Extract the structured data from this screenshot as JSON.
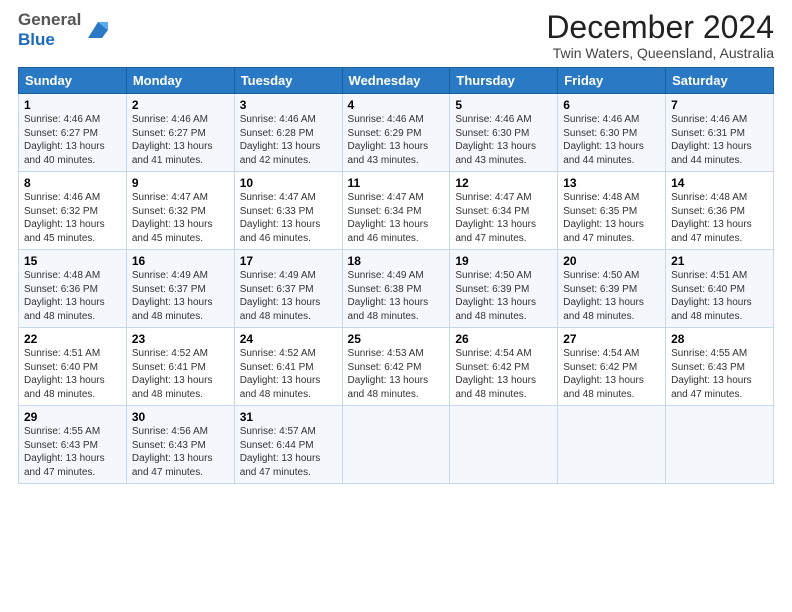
{
  "logo": {
    "general": "General",
    "blue": "Blue"
  },
  "title": "December 2024",
  "subtitle": "Twin Waters, Queensland, Australia",
  "days_header": [
    "Sunday",
    "Monday",
    "Tuesday",
    "Wednesday",
    "Thursday",
    "Friday",
    "Saturday"
  ],
  "weeks": [
    [
      {
        "day": "1",
        "sunrise": "Sunrise: 4:46 AM",
        "sunset": "Sunset: 6:27 PM",
        "daylight": "Daylight: 13 hours and 40 minutes."
      },
      {
        "day": "2",
        "sunrise": "Sunrise: 4:46 AM",
        "sunset": "Sunset: 6:27 PM",
        "daylight": "Daylight: 13 hours and 41 minutes."
      },
      {
        "day": "3",
        "sunrise": "Sunrise: 4:46 AM",
        "sunset": "Sunset: 6:28 PM",
        "daylight": "Daylight: 13 hours and 42 minutes."
      },
      {
        "day": "4",
        "sunrise": "Sunrise: 4:46 AM",
        "sunset": "Sunset: 6:29 PM",
        "daylight": "Daylight: 13 hours and 43 minutes."
      },
      {
        "day": "5",
        "sunrise": "Sunrise: 4:46 AM",
        "sunset": "Sunset: 6:30 PM",
        "daylight": "Daylight: 13 hours and 43 minutes."
      },
      {
        "day": "6",
        "sunrise": "Sunrise: 4:46 AM",
        "sunset": "Sunset: 6:30 PM",
        "daylight": "Daylight: 13 hours and 44 minutes."
      },
      {
        "day": "7",
        "sunrise": "Sunrise: 4:46 AM",
        "sunset": "Sunset: 6:31 PM",
        "daylight": "Daylight: 13 hours and 44 minutes."
      }
    ],
    [
      {
        "day": "8",
        "sunrise": "Sunrise: 4:46 AM",
        "sunset": "Sunset: 6:32 PM",
        "daylight": "Daylight: 13 hours and 45 minutes."
      },
      {
        "day": "9",
        "sunrise": "Sunrise: 4:47 AM",
        "sunset": "Sunset: 6:32 PM",
        "daylight": "Daylight: 13 hours and 45 minutes."
      },
      {
        "day": "10",
        "sunrise": "Sunrise: 4:47 AM",
        "sunset": "Sunset: 6:33 PM",
        "daylight": "Daylight: 13 hours and 46 minutes."
      },
      {
        "day": "11",
        "sunrise": "Sunrise: 4:47 AM",
        "sunset": "Sunset: 6:34 PM",
        "daylight": "Daylight: 13 hours and 46 minutes."
      },
      {
        "day": "12",
        "sunrise": "Sunrise: 4:47 AM",
        "sunset": "Sunset: 6:34 PM",
        "daylight": "Daylight: 13 hours and 47 minutes."
      },
      {
        "day": "13",
        "sunrise": "Sunrise: 4:48 AM",
        "sunset": "Sunset: 6:35 PM",
        "daylight": "Daylight: 13 hours and 47 minutes."
      },
      {
        "day": "14",
        "sunrise": "Sunrise: 4:48 AM",
        "sunset": "Sunset: 6:36 PM",
        "daylight": "Daylight: 13 hours and 47 minutes."
      }
    ],
    [
      {
        "day": "15",
        "sunrise": "Sunrise: 4:48 AM",
        "sunset": "Sunset: 6:36 PM",
        "daylight": "Daylight: 13 hours and 48 minutes."
      },
      {
        "day": "16",
        "sunrise": "Sunrise: 4:49 AM",
        "sunset": "Sunset: 6:37 PM",
        "daylight": "Daylight: 13 hours and 48 minutes."
      },
      {
        "day": "17",
        "sunrise": "Sunrise: 4:49 AM",
        "sunset": "Sunset: 6:37 PM",
        "daylight": "Daylight: 13 hours and 48 minutes."
      },
      {
        "day": "18",
        "sunrise": "Sunrise: 4:49 AM",
        "sunset": "Sunset: 6:38 PM",
        "daylight": "Daylight: 13 hours and 48 minutes."
      },
      {
        "day": "19",
        "sunrise": "Sunrise: 4:50 AM",
        "sunset": "Sunset: 6:39 PM",
        "daylight": "Daylight: 13 hours and 48 minutes."
      },
      {
        "day": "20",
        "sunrise": "Sunrise: 4:50 AM",
        "sunset": "Sunset: 6:39 PM",
        "daylight": "Daylight: 13 hours and 48 minutes."
      },
      {
        "day": "21",
        "sunrise": "Sunrise: 4:51 AM",
        "sunset": "Sunset: 6:40 PM",
        "daylight": "Daylight: 13 hours and 48 minutes."
      }
    ],
    [
      {
        "day": "22",
        "sunrise": "Sunrise: 4:51 AM",
        "sunset": "Sunset: 6:40 PM",
        "daylight": "Daylight: 13 hours and 48 minutes."
      },
      {
        "day": "23",
        "sunrise": "Sunrise: 4:52 AM",
        "sunset": "Sunset: 6:41 PM",
        "daylight": "Daylight: 13 hours and 48 minutes."
      },
      {
        "day": "24",
        "sunrise": "Sunrise: 4:52 AM",
        "sunset": "Sunset: 6:41 PM",
        "daylight": "Daylight: 13 hours and 48 minutes."
      },
      {
        "day": "25",
        "sunrise": "Sunrise: 4:53 AM",
        "sunset": "Sunset: 6:42 PM",
        "daylight": "Daylight: 13 hours and 48 minutes."
      },
      {
        "day": "26",
        "sunrise": "Sunrise: 4:54 AM",
        "sunset": "Sunset: 6:42 PM",
        "daylight": "Daylight: 13 hours and 48 minutes."
      },
      {
        "day": "27",
        "sunrise": "Sunrise: 4:54 AM",
        "sunset": "Sunset: 6:42 PM",
        "daylight": "Daylight: 13 hours and 48 minutes."
      },
      {
        "day": "28",
        "sunrise": "Sunrise: 4:55 AM",
        "sunset": "Sunset: 6:43 PM",
        "daylight": "Daylight: 13 hours and 47 minutes."
      }
    ],
    [
      {
        "day": "29",
        "sunrise": "Sunrise: 4:55 AM",
        "sunset": "Sunset: 6:43 PM",
        "daylight": "Daylight: 13 hours and 47 minutes."
      },
      {
        "day": "30",
        "sunrise": "Sunrise: 4:56 AM",
        "sunset": "Sunset: 6:43 PM",
        "daylight": "Daylight: 13 hours and 47 minutes."
      },
      {
        "day": "31",
        "sunrise": "Sunrise: 4:57 AM",
        "sunset": "Sunset: 6:44 PM",
        "daylight": "Daylight: 13 hours and 47 minutes."
      },
      null,
      null,
      null,
      null
    ]
  ]
}
